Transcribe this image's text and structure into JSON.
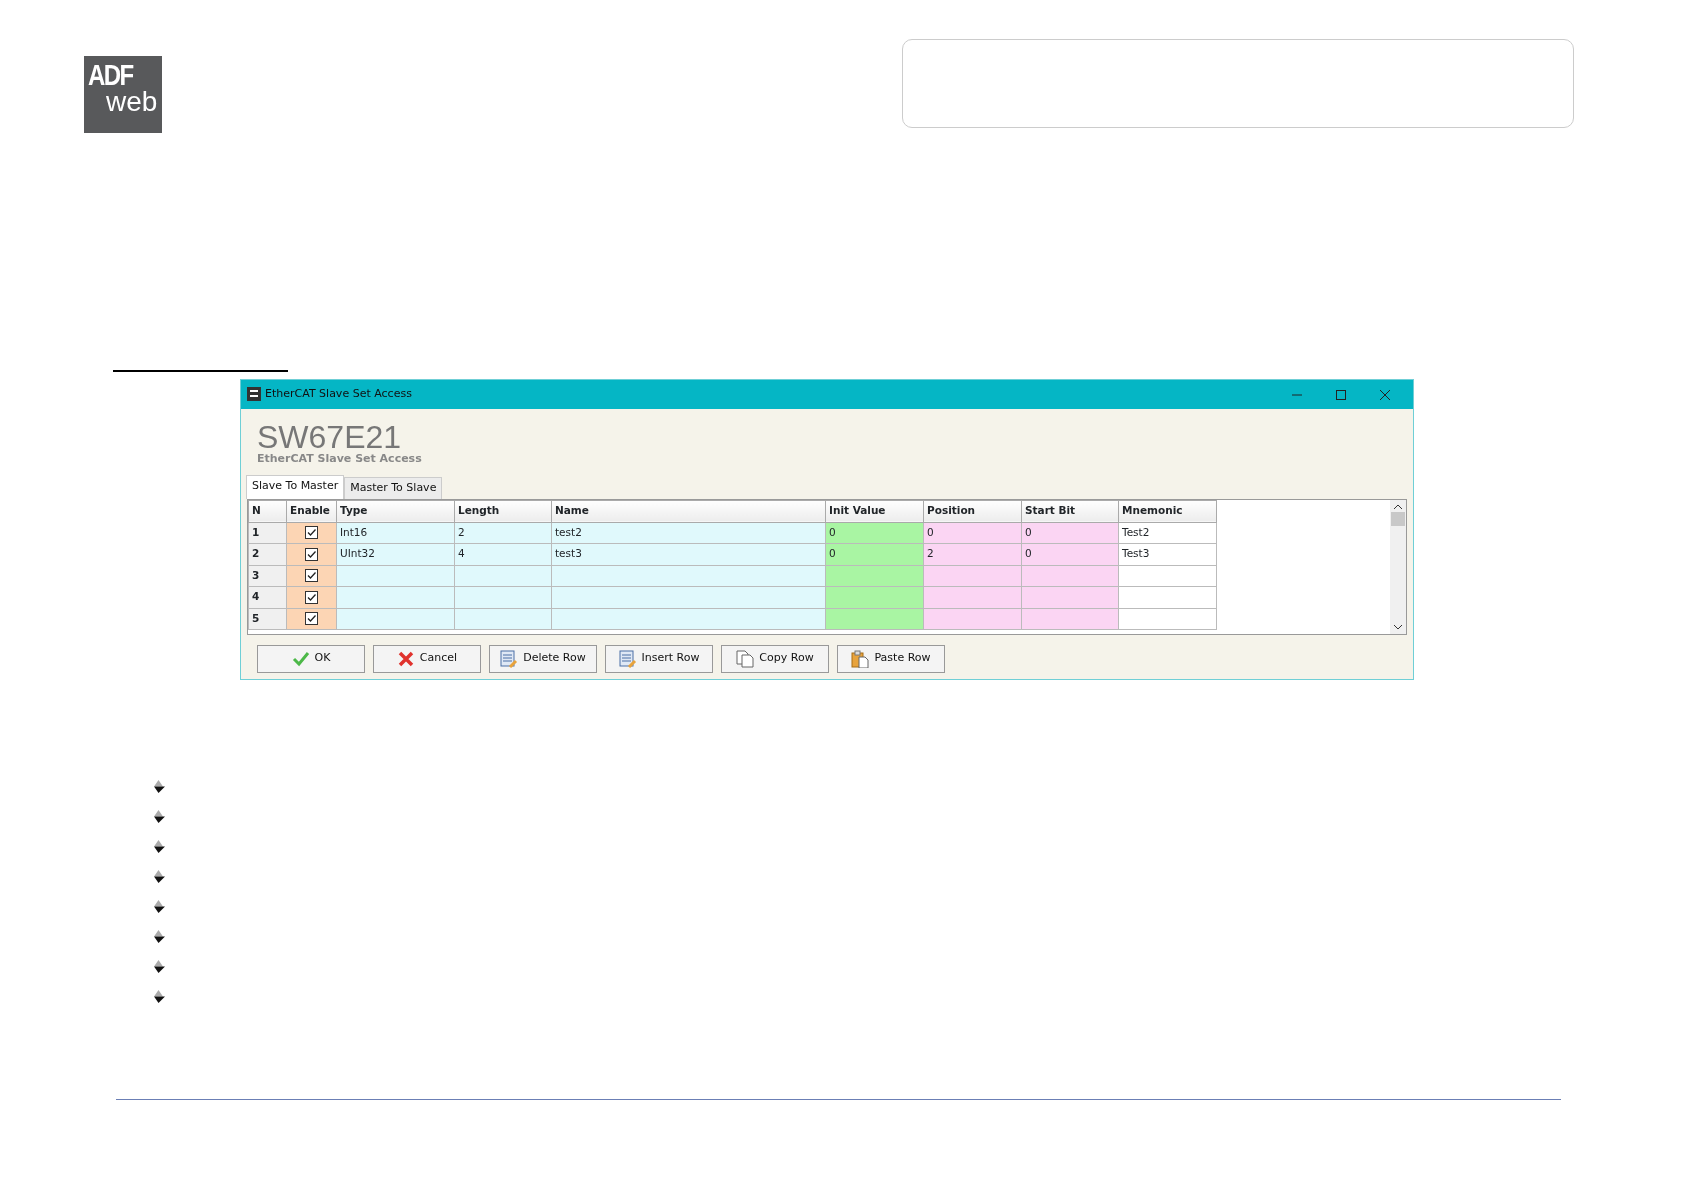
{
  "logo": {
    "top": "ADF",
    "bottom": "web"
  },
  "dialog": {
    "title": "EtherCAT Slave Set Access",
    "heading": "SW67E21",
    "subheading": "EtherCAT Slave Set Access",
    "tabs": [
      {
        "label": "Slave To Master",
        "selected": true
      },
      {
        "label": "Master To Slave",
        "selected": false
      }
    ],
    "columns": [
      {
        "label": "N",
        "color": "#f0f0f0"
      },
      {
        "label": "Enable",
        "color": "#fcd5b4"
      },
      {
        "label": "Type",
        "color": "#e0f9fc"
      },
      {
        "label": "Length",
        "color": "#e0f9fc"
      },
      {
        "label": "Name",
        "color": "#e0f9fc"
      },
      {
        "label": "Init Value",
        "color": "#a9f5a3"
      },
      {
        "label": "Position",
        "color": "#fbd5f3"
      },
      {
        "label": "Start Bit",
        "color": "#fbd5f3"
      },
      {
        "label": "Mnemonic",
        "color": "#ffffff"
      }
    ],
    "rows": [
      {
        "enabled": true,
        "cells": [
          "1",
          "",
          "Int16",
          "2",
          "test2",
          "0",
          "0",
          "0",
          "Test2"
        ]
      },
      {
        "enabled": true,
        "cells": [
          "2",
          "",
          "UInt32",
          "4",
          "test3",
          "0",
          "2",
          "0",
          "Test3"
        ]
      },
      {
        "enabled": true,
        "cells": [
          "3",
          "",
          "",
          "",
          "",
          "",
          "",
          "",
          ""
        ]
      },
      {
        "enabled": true,
        "cells": [
          "4",
          "",
          "",
          "",
          "",
          "",
          "",
          "",
          ""
        ]
      },
      {
        "enabled": true,
        "cells": [
          "5",
          "",
          "",
          "",
          "",
          "",
          "",
          "",
          ""
        ]
      }
    ],
    "buttons": [
      {
        "kind": "ok",
        "label": "OK"
      },
      {
        "kind": "cancel",
        "label": "Cancel"
      },
      {
        "kind": "delete",
        "label": "Delete Row"
      },
      {
        "kind": "insert",
        "label": "Insert Row"
      },
      {
        "kind": "copy",
        "label": "Copy Row"
      },
      {
        "kind": "paste",
        "label": "Paste Row"
      }
    ]
  }
}
